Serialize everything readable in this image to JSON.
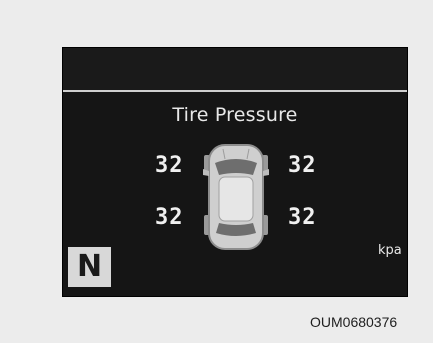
{
  "display": {
    "title": "Tire Pressure",
    "pressures": {
      "front_left": "32",
      "front_right": "32",
      "rear_left": "32",
      "rear_right": "32"
    },
    "unit": "kpa",
    "gear": "N"
  },
  "caption": "OUM0680376",
  "colors": {
    "panel_background": "#151515",
    "text": "#f0f0f0",
    "gear_badge": "#d8d8d8",
    "page_background": "#ececec"
  }
}
